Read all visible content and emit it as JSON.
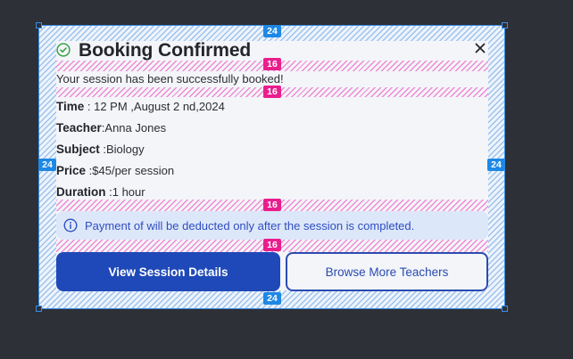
{
  "dialog": {
    "title": "Booking Confirmed",
    "subtitle": "Your session has been successfully booked!",
    "details": [
      {
        "label": "Time",
        "sep": " : ",
        "value": "12 PM ,August 2 nd,2024"
      },
      {
        "label": "Teacher",
        "sep": ":",
        "value": "Anna  Jones"
      },
      {
        "label": "Subject",
        "sep": " :",
        "value": "Biology"
      },
      {
        "label": "Price",
        "sep": " :",
        "value": "$45/per session"
      },
      {
        "label": "Duration",
        "sep": " :",
        "value": "1 hour"
      }
    ],
    "notice": "Payment of will be deducted only after the session is completed.",
    "primary_button": "View  Session Details",
    "secondary_button": "Browse More Teachers"
  },
  "spacing_annotations": {
    "padding": "24",
    "gap": "16"
  },
  "colors": {
    "primary": "#1f49b8",
    "success": "#2e9e3e",
    "info_bg": "#dde7fa",
    "annotation_padding": "#1e88e5",
    "annotation_gap": "#e91e8c"
  },
  "icons": [
    "check-circle-icon",
    "close-icon",
    "info-icon"
  ]
}
